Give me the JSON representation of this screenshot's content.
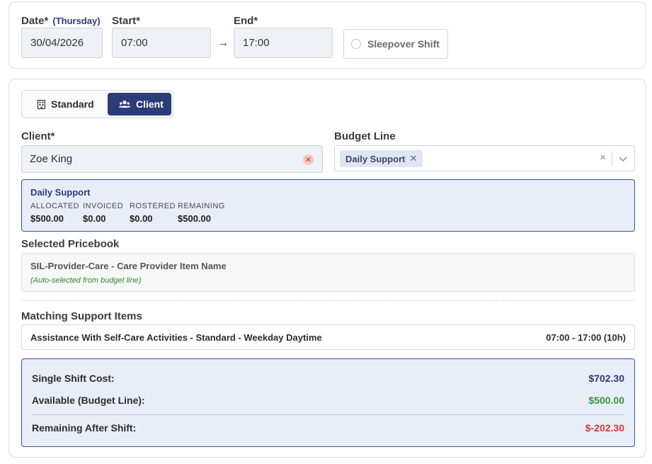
{
  "schedule": {
    "date_label": "Date*",
    "day_label": "(Thursday)",
    "date_value": "30/04/2026",
    "start_label": "Start*",
    "start_value": "07:00",
    "end_label": "End*",
    "end_value": "17:00",
    "arrow": "→",
    "sleepover_label": "Sleepover Shift",
    "sleepover_checked": false
  },
  "mode_toggle": {
    "options": [
      {
        "label": "Standard",
        "icon": "building-icon",
        "active": false
      },
      {
        "label": "Client",
        "icon": "users-icon",
        "active": true
      }
    ]
  },
  "client": {
    "label": "Client*",
    "value": "Zoe King"
  },
  "budget_line": {
    "label": "Budget Line",
    "chips": [
      "Daily Support"
    ],
    "clear": "×"
  },
  "budget_summary": {
    "title": "Daily Support",
    "columns": [
      {
        "heading": "ALLOCATED",
        "value": "$500.00"
      },
      {
        "heading": "INVOICED",
        "value": "$0.00"
      },
      {
        "heading": "ROSTERED",
        "value": "$0.00"
      },
      {
        "heading": "REMAINING",
        "value": "$500.00"
      }
    ]
  },
  "pricebook": {
    "label": "Selected Pricebook",
    "name": "SIL-Provider-Care - Care Provider Item Name",
    "note": "(Auto-selected from budget line)"
  },
  "support_items": {
    "label": "Matching Support Items",
    "items": [
      {
        "name": "Assistance With Self-Care Activities - Standard - Weekday Daytime",
        "time": "07:00 - 17:00 (10h)"
      }
    ]
  },
  "cost": {
    "rows": [
      {
        "label": "Single Shift Cost:",
        "value": "$702.30",
        "color": "#2c3c78"
      },
      {
        "label": "Available (Budget Line):",
        "value": "$500.00",
        "color": "#2f9a3a"
      },
      {
        "label": "Remaining After Shift:",
        "value": "$-202.30",
        "color": "#d23b3b"
      }
    ]
  },
  "colors": {
    "accent": "#2c3c78",
    "positive": "#2f9a3a",
    "negative": "#d23b3b",
    "panel_bg": "#e8edf8"
  }
}
